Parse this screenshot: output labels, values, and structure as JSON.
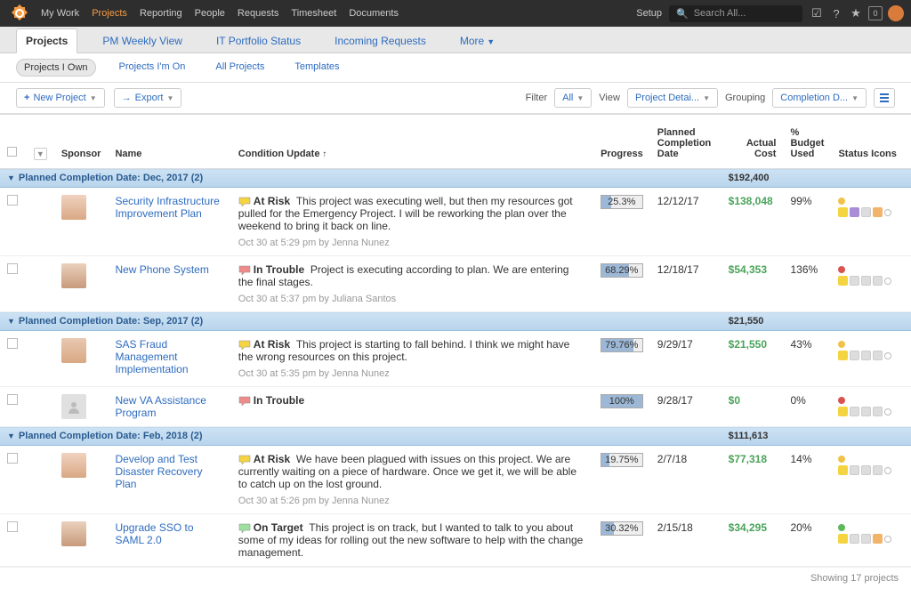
{
  "topnav": {
    "items": [
      "My Work",
      "Projects",
      "Reporting",
      "People",
      "Requests",
      "Timesheet",
      "Documents"
    ],
    "active_index": 1,
    "setup": "Setup",
    "search_placeholder": "Search All..."
  },
  "tabs": {
    "items": [
      "Projects",
      "PM Weekly View",
      "IT Portfolio Status",
      "Incoming Requests",
      "More"
    ],
    "active_index": 0
  },
  "subtabs": {
    "items": [
      "Projects I Own",
      "Projects I'm On",
      "All Projects",
      "Templates"
    ],
    "active_index": 0
  },
  "toolbar": {
    "new_project": "New Project",
    "export": "Export",
    "filter_label": "Filter",
    "filter_value": "All",
    "view_label": "View",
    "view_value": "Project Detai...",
    "grouping_label": "Grouping",
    "grouping_value": "Completion D..."
  },
  "columns": {
    "sponsor": "Sponsor",
    "name": "Name",
    "condition": "Condition Update",
    "progress": "Progress",
    "planned_date": "Planned Completion Date",
    "actual_cost": "Actual Cost",
    "budget_used": "% Budget Used",
    "status_icons": "Status Icons"
  },
  "groups": [
    {
      "label": "Planned Completion Date: Dec, 2017 (2)",
      "actual_cost": "$192,400",
      "rows": [
        {
          "name": "Security Infrastructure Improvement Plan",
          "condition_status": "At Risk",
          "condition_text": "This project was executing well, but then my resources got pulled for the Emergency Project. I will be reworking the plan over the weekend to bring it back on line.",
          "condition_meta": "Oct 30 at 5:29 pm by Jenna Nunez",
          "progress": "25.3%",
          "progress_pct": 25.3,
          "date": "12/12/17",
          "cost": "$138,048",
          "budget": "99%",
          "flag": "yellow",
          "status": [
            "yellow",
            "purple",
            "gray",
            "orange",
            "circle"
          ]
        },
        {
          "name": "New Phone System",
          "condition_status": "In Trouble",
          "condition_text": "Project is executing according to plan. We are entering the final stages.",
          "condition_meta": "Oct 30 at 5:37 pm by Juliana Santos",
          "progress": "68.29%",
          "progress_pct": 68.29,
          "date": "12/18/17",
          "cost": "$54,353",
          "budget": "136%",
          "flag": "red",
          "status": [
            "yellow",
            "gray",
            "gray",
            "gray",
            "circle"
          ]
        }
      ]
    },
    {
      "label": "Planned Completion Date: Sep, 2017 (2)",
      "actual_cost": "$21,550",
      "rows": [
        {
          "name": "SAS Fraud Management Implementation",
          "condition_status": "At Risk",
          "condition_text": "This project is starting to fall behind. I think we might have the wrong resources on this project.",
          "condition_meta": "Oct 30 at 5:35 pm by Jenna Nunez",
          "progress": "79.76%",
          "progress_pct": 79.76,
          "date": "9/29/17",
          "cost": "$21,550",
          "budget": "43%",
          "flag": "yellow",
          "status": [
            "yellow",
            "gray",
            "gray",
            "gray",
            "circle"
          ]
        },
        {
          "name": "New VA Assistance Program",
          "condition_status": "In Trouble",
          "condition_text": "",
          "condition_meta": "",
          "progress": "100%",
          "progress_pct": 100,
          "date": "9/28/17",
          "cost": "$0",
          "budget": "0%",
          "flag": "red",
          "placeholder_avatar": true,
          "status": [
            "yellow",
            "gray",
            "gray",
            "gray",
            "circle"
          ]
        }
      ]
    },
    {
      "label": "Planned Completion Date: Feb, 2018 (2)",
      "actual_cost": "$111,613",
      "rows": [
        {
          "name": "Develop and Test Disaster Recovery Plan",
          "condition_status": "At Risk",
          "condition_text": "We have been plagued with issues on this project. We are currently waiting on a piece of hardware. Once we get it, we will be able to catch up on the lost ground.",
          "condition_meta": "Oct 30 at 5:26 pm by Jenna Nunez",
          "progress": "19.75%",
          "progress_pct": 19.75,
          "date": "2/7/18",
          "cost": "$77,318",
          "budget": "14%",
          "flag": "yellow",
          "status": [
            "yellow",
            "gray",
            "gray",
            "gray",
            "circle"
          ]
        },
        {
          "name": "Upgrade SSO to SAML 2.0",
          "condition_status": "On Target",
          "condition_text": "This project is on track, but I wanted to talk to you about some of my ideas for rolling out the new software to help with the change management.",
          "condition_meta": "",
          "progress": "30.32%",
          "progress_pct": 30.32,
          "date": "2/15/18",
          "cost": "$34,295",
          "budget": "20%",
          "flag": "green",
          "status": [
            "yellow",
            "gray",
            "gray",
            "orange",
            "circle"
          ]
        }
      ]
    }
  ],
  "footer": {
    "showing": "Showing 17 projects"
  }
}
